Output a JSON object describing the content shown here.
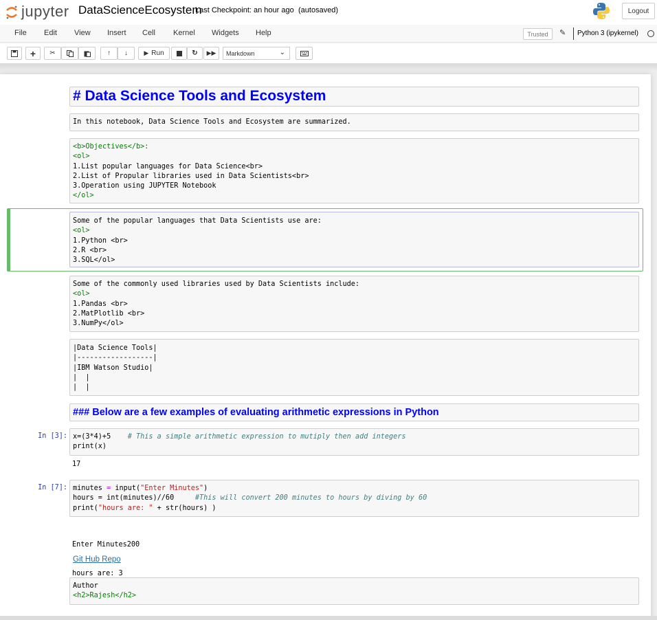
{
  "header": {
    "logo_text": "jupyter",
    "notebook_name": "DataScienceEcosystem",
    "checkpoint": "Last Checkpoint: an hour ago",
    "autosaved": "(autosaved)",
    "logout_label": "Logout"
  },
  "menubar": {
    "items": [
      "File",
      "Edit",
      "View",
      "Insert",
      "Cell",
      "Kernel",
      "Widgets",
      "Help"
    ],
    "trusted": "Trusted",
    "kernel": "Python 3 (ipykernel)"
  },
  "toolbar": {
    "run_label": "Run",
    "cell_type": "Markdown"
  },
  "cells": {
    "heading1": "# Data Science Tools and Ecosystem",
    "intro": "In this notebook, Data Science Tools and Ecosystem are summarized.",
    "objectives": {
      "l1": "<b>Objectives</b>:",
      "l2": "<ol>",
      "l3": "1.List popular languages for Data Science<br>",
      "l4": "2.List of Propular libraries used in Data Scientists<br>",
      "l5": "3.Operation using JUPYTER Notebook",
      "l6": "</ol>"
    },
    "languages": {
      "l1": "Some of the popular languages that Data Scientists use are:",
      "l2": "<ol>",
      "l3": "1.Python <br>",
      "l4": "2.R <br>",
      "l5": "3.SQL</ol>"
    },
    "libraries": {
      "l1": "Some of the commonly used libraries used by Data Scientists include:",
      "l2": "<ol>",
      "l3": "1.Pandas <br>",
      "l4": "2.MatPlotlib <br>",
      "l5": "3.NumPy</ol>"
    },
    "table": {
      "l1": "|Data Science Tools|",
      "l2": "|------------------|",
      "l3": "|IBM Watson Studio|",
      "l4": "|  |",
      "l5": "|  |"
    },
    "heading3": "### Below are a few examples of evaluating arithmetic expressions in Python",
    "code1": {
      "prompt": "In [3]:",
      "line1_code": "x=(3*4)+5",
      "line1_comment": "# This a simple arithmetic expression to mutiply then add integers",
      "line2": "print(x)",
      "output": "17"
    },
    "code2": {
      "prompt": "In [7]:",
      "line1_a": "minutes ",
      "line1_op": "=",
      "line1_b": " input(",
      "line1_str": "\"Enter Minutes\"",
      "line1_c": ")",
      "line2_code": "hours = int(minutes)//60",
      "line2_comment": "#This will convert 200 minutes to hours by diving by 60",
      "line3_a": "print(",
      "line3_str": "\"hours are: \"",
      "line3_b": " + str(hours) )",
      "output_l1": "Enter Minutes200",
      "output_l2": "hours are: 3"
    },
    "link": "Git Hub Repo",
    "author": {
      "l1": "Author",
      "l2": "<h2>Rajesh</h2>"
    }
  }
}
